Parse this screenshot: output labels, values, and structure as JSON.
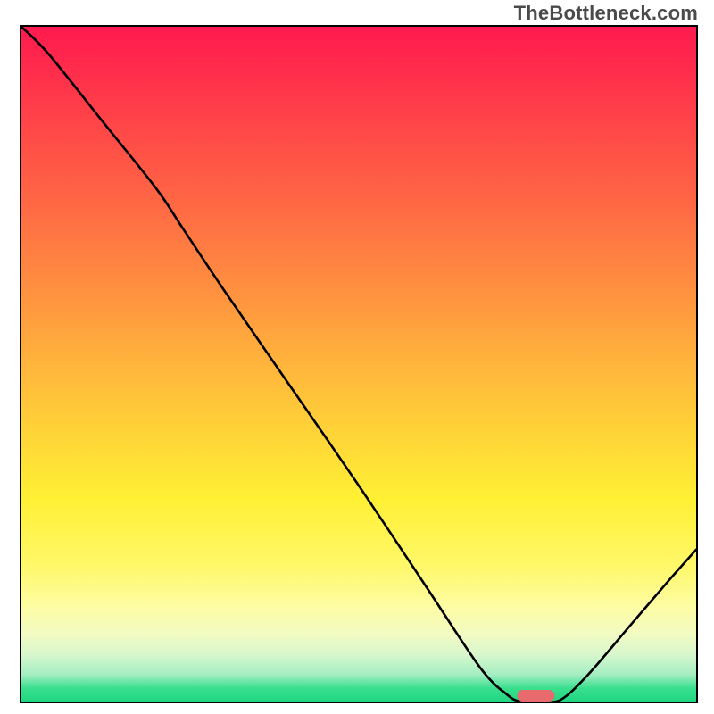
{
  "watermark": "TheBottleneck.com",
  "chart_data": {
    "type": "line",
    "title": "",
    "xlabel": "",
    "ylabel": "",
    "xlim": [
      0,
      100
    ],
    "ylim": [
      0,
      100
    ],
    "series": [
      {
        "name": "curve",
        "x": [
          0,
          4,
          12,
          20,
          24,
          30,
          40,
          50,
          60,
          68,
          72,
          74,
          77,
          80,
          84,
          90,
          96,
          100
        ],
        "values": [
          100,
          96,
          86,
          76,
          70,
          61,
          46.5,
          32,
          17,
          5,
          1,
          0,
          0,
          0.3,
          4,
          11,
          18,
          22.5
        ]
      }
    ],
    "marker": {
      "name": "optimal-range",
      "x_start": 73.5,
      "x_end": 79,
      "y": 0,
      "color": "#e86a6c"
    },
    "gradient_colors": {
      "top": "#ff1a4f",
      "mid_upper": "#ff8d40",
      "mid": "#ffd338",
      "mid_lower": "#fdfda4",
      "bottom": "#20d680"
    }
  }
}
